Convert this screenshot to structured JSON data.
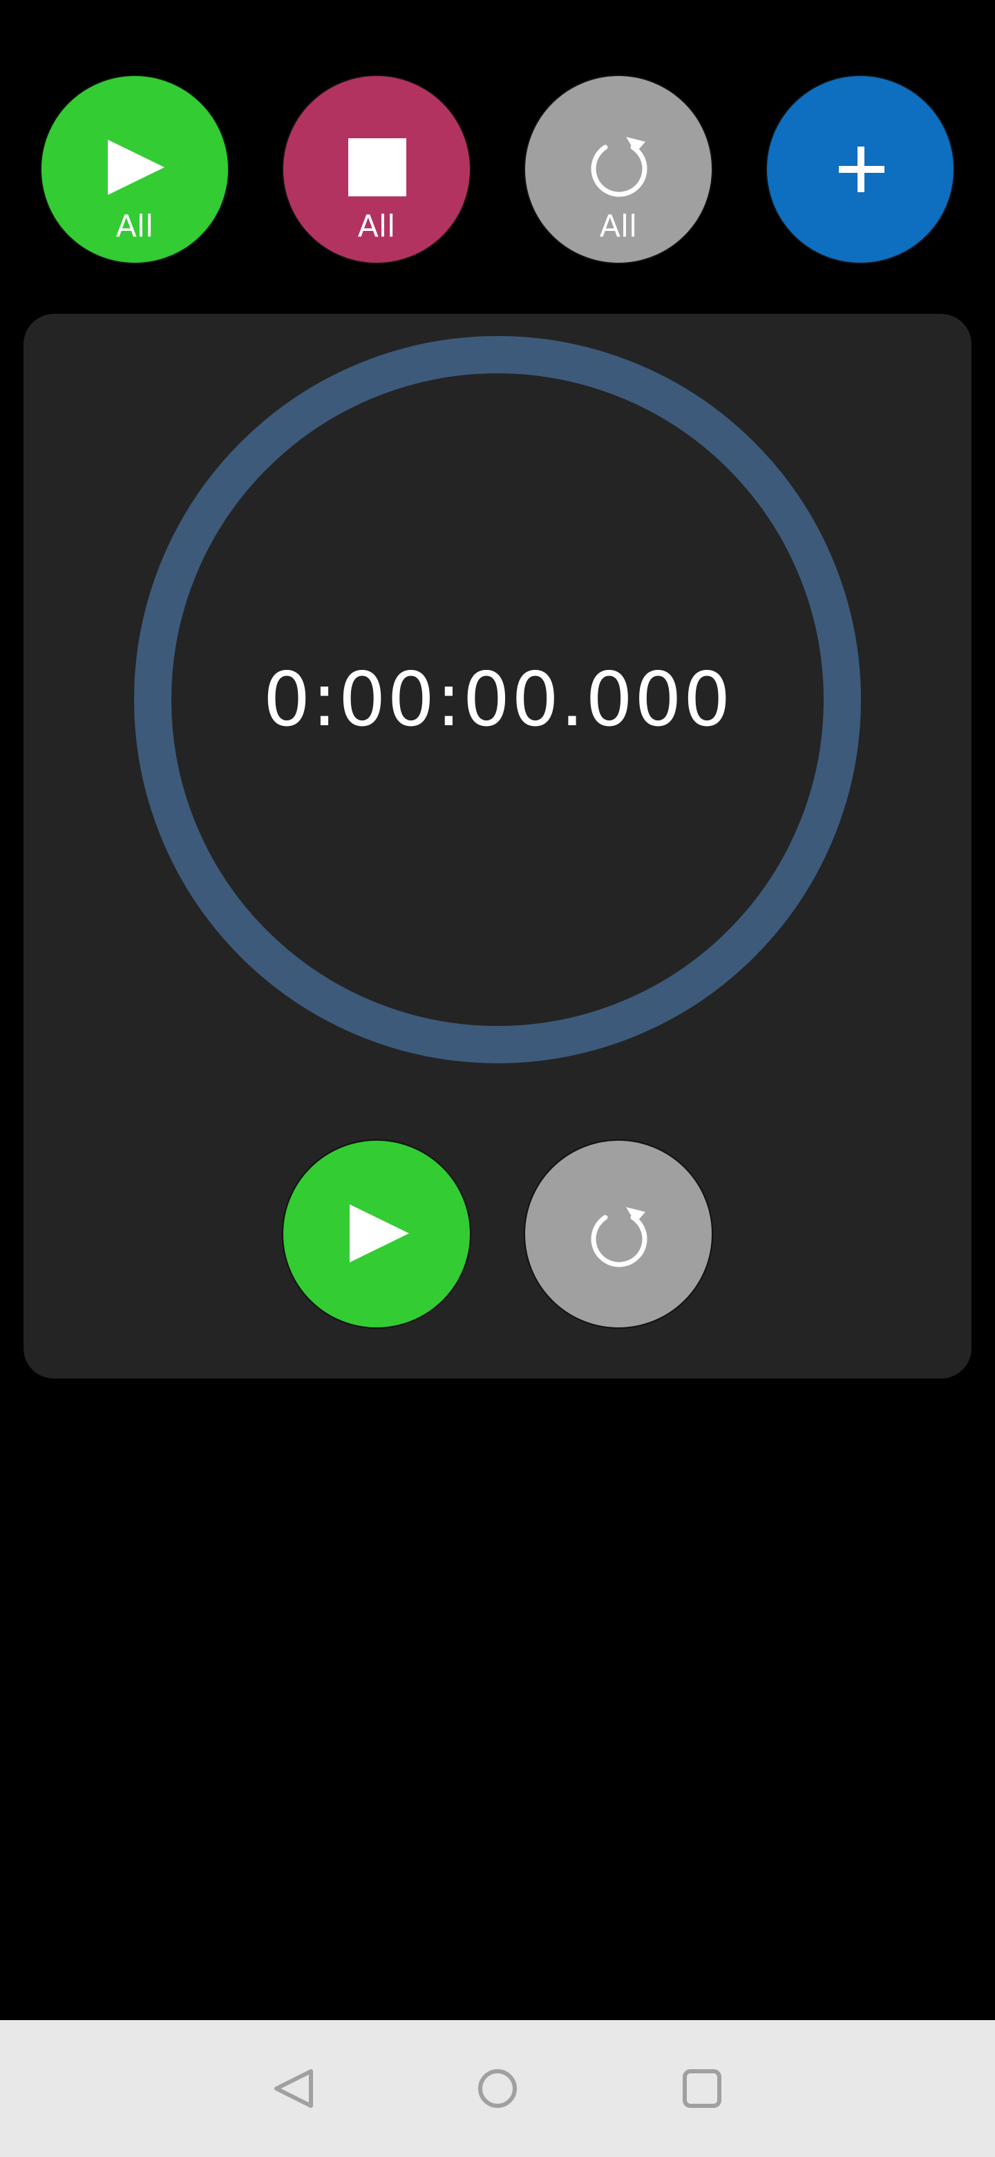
{
  "toolbar": {
    "start_all_label": "All",
    "stop_all_label": "All",
    "reset_all_label": "All",
    "icons": [
      "play-icon",
      "stop-icon",
      "reset-icon",
      "plus-icon"
    ]
  },
  "stopwatch": {
    "time": "0:00:00.000",
    "controls": [
      "play-icon",
      "reset-icon"
    ]
  },
  "navigation": {
    "icons": [
      "back-icon",
      "home-icon",
      "recents-icon"
    ]
  },
  "colors": {
    "background": "#000000",
    "card": "#242424",
    "ring": "#3d5a7a",
    "start": "#33cc33",
    "stop": "#b33360",
    "reset": "#a0a0a0",
    "add": "#0e6ebf",
    "navbar": "#e8e8e8"
  }
}
